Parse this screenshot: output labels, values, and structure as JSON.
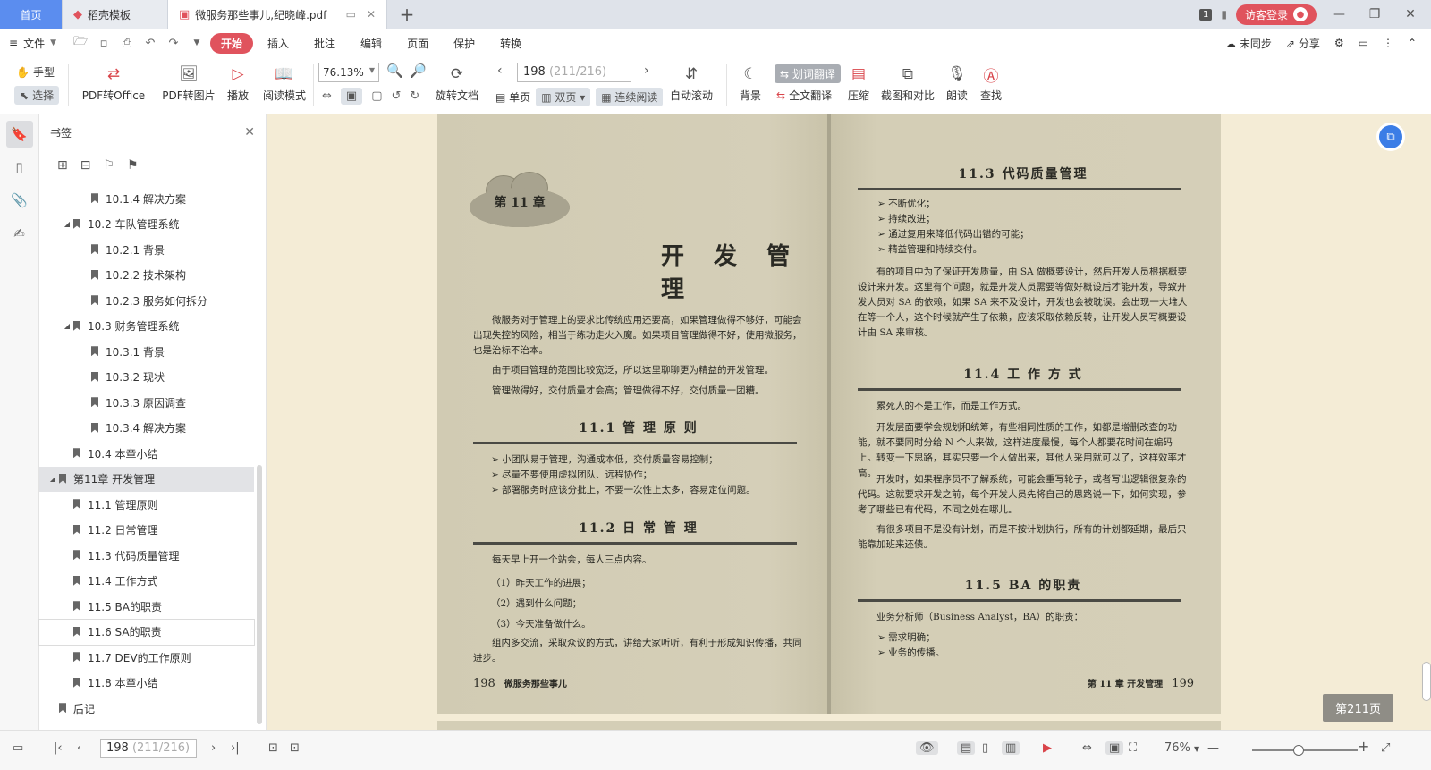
{
  "tabs": {
    "home": "首页",
    "template": "稻壳模板",
    "document": "微服务那些事儿,纪晓峰.pdf",
    "notif_count": "1",
    "login": "访客登录"
  },
  "menu": {
    "file": "文件",
    "tabs": [
      "开始",
      "插入",
      "批注",
      "编辑",
      "页面",
      "保护",
      "转换"
    ],
    "unsynced": "未同步",
    "share": "分享"
  },
  "toolbar": {
    "hand": "手型",
    "select": "选择",
    "pdf_to_office": "PDF转Office",
    "pdf_to_image": "PDF转图片",
    "play": "播放",
    "read_mode": "阅读模式",
    "zoom": "76.13%",
    "rotate": "旋转文档",
    "page_current": "198",
    "page_total": "(211/216)",
    "single": "单页",
    "double": "双页",
    "continuous": "连续阅读",
    "autoscroll": "自动滚动",
    "background": "背景",
    "word_translate": "划词翻译",
    "full_translate": "全文翻译",
    "compress": "压缩",
    "screenshot_compare": "截图和对比",
    "read_aloud": "朗读",
    "find": "查找"
  },
  "bookmarks": {
    "title": "书签",
    "items": [
      {
        "label": "10.1.4 解决方案",
        "level": 2,
        "arrow": ""
      },
      {
        "label": "10.2 车队管理系统",
        "level": 1,
        "arrow": "◢"
      },
      {
        "label": "10.2.1 背景",
        "level": 2,
        "arrow": ""
      },
      {
        "label": "10.2.2 技术架构",
        "level": 2,
        "arrow": ""
      },
      {
        "label": "10.2.3 服务如何拆分",
        "level": 2,
        "arrow": ""
      },
      {
        "label": "10.3 财务管理系统",
        "level": 1,
        "arrow": "◢"
      },
      {
        "label": "10.3.1 背景",
        "level": 2,
        "arrow": ""
      },
      {
        "label": "10.3.2 现状",
        "level": 2,
        "arrow": ""
      },
      {
        "label": "10.3.3 原因调查",
        "level": 2,
        "arrow": ""
      },
      {
        "label": "10.3.4 解决方案",
        "level": 2,
        "arrow": ""
      },
      {
        "label": "10.4 本章小结",
        "level": 1,
        "arrow": ""
      },
      {
        "label": "第11章 开发管理",
        "level": 0,
        "arrow": "◢"
      },
      {
        "label": "11.1 管理原则",
        "level": 1,
        "arrow": ""
      },
      {
        "label": "11.2 日常管理",
        "level": 1,
        "arrow": ""
      },
      {
        "label": "11.3 代码质量管理",
        "level": 1,
        "arrow": ""
      },
      {
        "label": "11.4 工作方式",
        "level": 1,
        "arrow": ""
      },
      {
        "label": "11.5 BA的职责",
        "level": 1,
        "arrow": ""
      },
      {
        "label": "11.6 SA的职责",
        "level": 1,
        "arrow": ""
      },
      {
        "label": "11.7 DEV的工作原则",
        "level": 1,
        "arrow": ""
      },
      {
        "label": "11.8 本章小结",
        "level": 1,
        "arrow": ""
      },
      {
        "label": "后记",
        "level": 0,
        "arrow": ""
      }
    ],
    "selected_index": 11,
    "hover_index": 17
  },
  "page_left": {
    "chapter_label": "第 11 章",
    "chapter_title": "开 发 管 理",
    "para1": "微服务对于管理上的要求比传统应用还要高，如果管理做得不够好，可能会出现失控的风险，相当于练功走火入魔。如果项目管理做得不好，使用微服务，也是治标不治本。",
    "para2": "由于项目管理的范围比较宽泛，所以这里聊聊更为精益的开发管理。",
    "para3": "管理做得好，交付质量才会高；管理做得不好，交付质量一团糟。",
    "h_11_1": "11.1 管 理 原 则",
    "bullets_11_1": [
      "小团队易于管理，沟通成本低，交付质量容易控制；",
      "尽量不要使用虚拟团队、远程协作；",
      "部署服务时应该分批上，不要一次性上太多，容易定位问题。"
    ],
    "h_11_2": "11.2 日 常 管 理",
    "para4": "每天早上开一个站会，每人三点内容。",
    "list_11_2": [
      "（1）昨天工作的进展；",
      "（2）遇到什么问题；",
      "（3）今天准备做什么。"
    ],
    "para5": "组内多交流，采取众议的方式，讲给大家听听，有利于形成知识传播，共同进步。",
    "page_no": "198",
    "footer": "微服务那些事儿"
  },
  "page_right": {
    "h_11_3": "11.3 代码质量管理",
    "bullets_11_3": [
      "不断优化；",
      "持续改进；",
      "通过复用来降低代码出错的可能；",
      "精益管理和持续交付。"
    ],
    "para1": "有的项目中为了保证开发质量，由 SA 做概要设计，然后开发人员根据概要设计来开发。这里有个问题，就是开发人员需要等做好概设后才能开发，导致开发人员对 SA 的依赖，如果 SA 来不及设计，开发也会被耽误。会出现一大堆人在等一个人，这个时候就产生了依赖，应该采取依赖反转，让开发人员写概要设计由 SA 来审核。",
    "h_11_4": "11.4 工 作 方 式",
    "para2": "累死人的不是工作，而是工作方式。",
    "para3": "开发层面要学会规划和统筹，有些相同性质的工作，如都是增删改查的功能，就不要同时分给 N 个人来做，这样进度最慢，每个人都要花时间在编码上。转变一下思路，其实只要一个人做出来，其他人采用就可以了，这样效率才高。",
    "para4": "开发时，如果程序员不了解系统，可能会重写轮子，或者写出逻辑很复杂的代码。这就要求开发之前，每个开发人员先将自己的思路说一下，如何实现，参考了哪些已有代码，不同之处在哪儿。",
    "para5": "有很多项目不是没有计划，而是不按计划执行，所有的计划都延期，最后只能靠加班来还债。",
    "h_11_5": "11.5 BA 的职责",
    "para6": "业务分析师（Business Analyst，BA）的职责：",
    "bullets_11_5": [
      "需求明确；",
      "业务的传播。"
    ],
    "footer": "第 11 章 开发管理",
    "page_no": "199"
  },
  "viewer": {
    "page_indicator": "第211页"
  },
  "statusbar": {
    "page_current": "198",
    "page_total": "(211/216)",
    "zoom": "76%"
  }
}
